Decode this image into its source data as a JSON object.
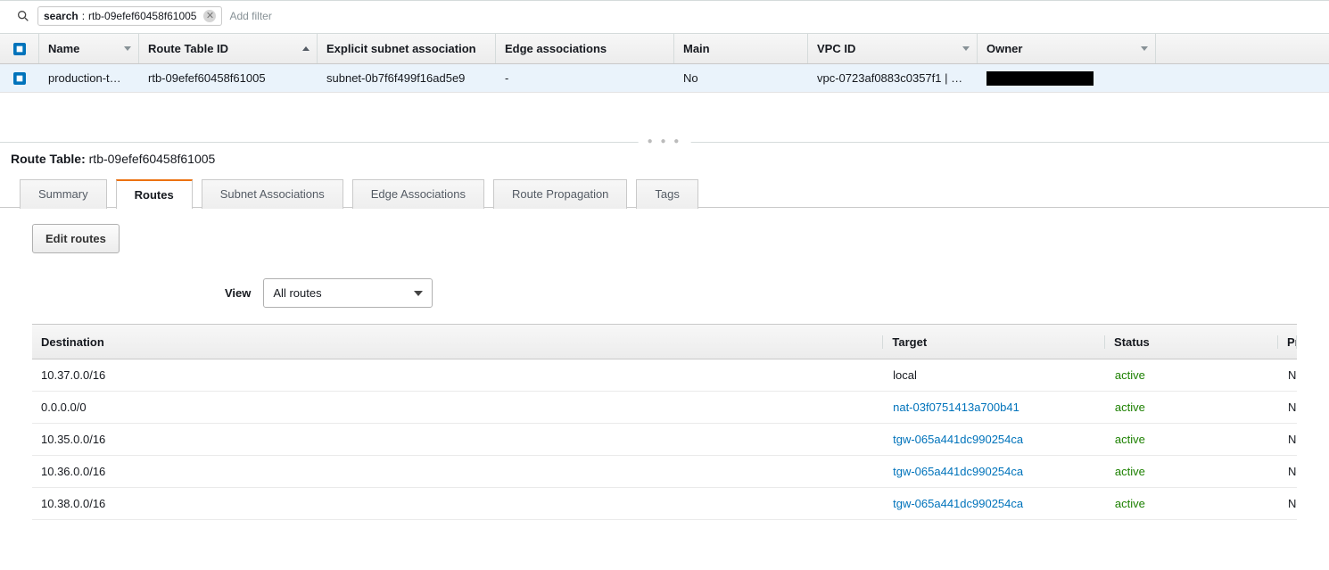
{
  "filter": {
    "tag_key": "search",
    "tag_value": "rtb-09efef60458f61005",
    "add_filter_placeholder": "Add filter"
  },
  "columns": {
    "name": "Name",
    "rtid": "Route Table ID",
    "subnet": "Explicit subnet association",
    "edge": "Edge associations",
    "main": "Main",
    "vpc": "VPC ID",
    "owner": "Owner"
  },
  "row": {
    "name": "production-t…",
    "rtid": "rtb-09efef60458f61005",
    "subnet": "subnet-0b7f6f499f16ad5e9",
    "edge": "-",
    "main": "No",
    "vpc": "vpc-0723af0883c0357f1 | …"
  },
  "detail": {
    "label": "Route Table:",
    "id": "rtb-09efef60458f61005"
  },
  "tabs": {
    "summary": "Summary",
    "routes": "Routes",
    "subnet_assoc": "Subnet Associations",
    "edge_assoc": "Edge Associations",
    "propagation": "Route Propagation",
    "tags": "Tags"
  },
  "buttons": {
    "edit_routes": "Edit routes"
  },
  "view": {
    "label": "View",
    "selected": "All routes"
  },
  "routes_table": {
    "headers": {
      "destination": "Destination",
      "target": "Target",
      "status": "Status",
      "propagated": "Propagated"
    },
    "rows": [
      {
        "destination": "10.37.0.0/16",
        "target": "local",
        "target_link": false,
        "status": "active",
        "propagated": "No"
      },
      {
        "destination": "0.0.0.0/0",
        "target": "nat-03f0751413a700b41",
        "target_link": true,
        "status": "active",
        "propagated": "No"
      },
      {
        "destination": "10.35.0.0/16",
        "target": "tgw-065a441dc990254ca",
        "target_link": true,
        "status": "active",
        "propagated": "No"
      },
      {
        "destination": "10.36.0.0/16",
        "target": "tgw-065a441dc990254ca",
        "target_link": true,
        "status": "active",
        "propagated": "No"
      },
      {
        "destination": "10.38.0.0/16",
        "target": "tgw-065a441dc990254ca",
        "target_link": true,
        "status": "active",
        "propagated": "No"
      }
    ]
  }
}
